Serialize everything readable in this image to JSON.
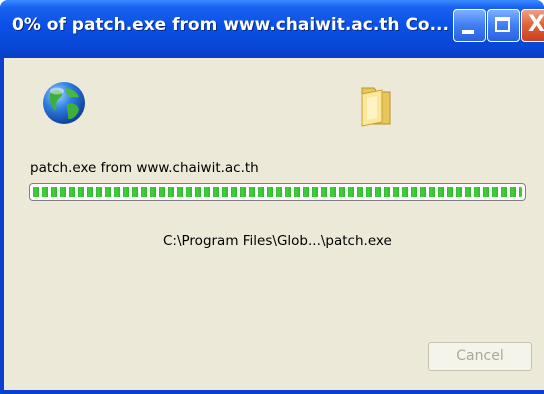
{
  "window": {
    "title": "0% of patch.exe from www.chaiwit.ac.th Co...",
    "controls": {
      "minimize_icon": "minimize-icon",
      "maximize_icon": "maximize-icon",
      "close_glyph": "X"
    }
  },
  "download": {
    "source_label": "patch.exe from www.chaiwit.ac.th",
    "destination_path": "C:\\Program Files\\Glob...\\patch.exe",
    "progress_fraction": 1.0,
    "source_icon": "globe-icon",
    "destination_icon": "folder-icon"
  },
  "buttons": {
    "cancel_label": "Cancel",
    "cancel_enabled": false
  },
  "colors": {
    "titlebar": "#0a50e6",
    "client_bg": "#ece9d8",
    "progress_green": "#36b72f",
    "close_red": "#e0603a"
  }
}
